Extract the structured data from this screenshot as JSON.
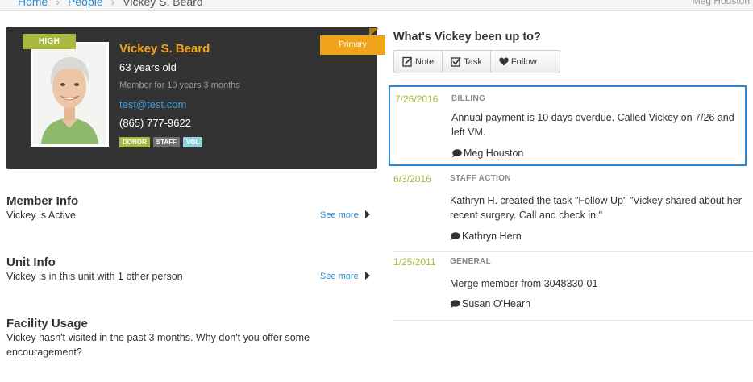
{
  "breadcrumb": {
    "home": "Home",
    "people": "People",
    "current": "Vickey S. Beard"
  },
  "top_user": "Meg Houston",
  "profile": {
    "priority": "HIGH",
    "ribbon": "Primary",
    "name": "Vickey S. Beard",
    "age": "63 years old",
    "tenure": "Member for 10 years 3 months",
    "email": "test@test.com",
    "phone": "(865) 777-9622",
    "tags": [
      "DONOR",
      "STAFF",
      "VOL"
    ]
  },
  "sections": {
    "member_info": {
      "title": "Member Info",
      "body": "Vickey is Active",
      "link": "See more"
    },
    "unit_info": {
      "title": "Unit Info",
      "body": "Vickey is in this unit with 1 other person",
      "link": "See more"
    },
    "facility": {
      "title": "Facility Usage",
      "body": "Vickey hasn't visited in the past 3 months. Why don't you offer some encouragement?"
    }
  },
  "activity": {
    "title": "What's Vickey been up to?",
    "buttons": {
      "note": "Note",
      "task": "Task",
      "follow": "Follow"
    },
    "items": [
      {
        "date": "7/26/2016",
        "category": "BILLING",
        "text": "Annual payment is 10 days overdue. Called Vickey on 7/26 and left VM.",
        "user": "Meg Houston"
      },
      {
        "date": "6/3/2016",
        "category": "STAFF ACTION",
        "text": "Kathryn H. created the task \"Follow Up\"   \"Vickey shared about her recent surgery.  Call and check in.\"",
        "user": "Kathryn Hern"
      },
      {
        "date": "1/25/2011",
        "category": "GENERAL",
        "text": "Merge member from 3048330-01",
        "user": "Susan O'Hearn"
      }
    ]
  },
  "colors": {
    "accent_orange": "#f0a41c",
    "accent_green": "#a9b83e",
    "link_blue": "#2a8ac4",
    "selection_blue": "#2b87d1",
    "card_bg": "#333333"
  },
  "icons": {
    "note": "note-icon",
    "task": "task-checkbox-icon",
    "follow": "heart-icon",
    "comment": "speech-bubble-icon",
    "see_more": "caret-right-icon"
  }
}
